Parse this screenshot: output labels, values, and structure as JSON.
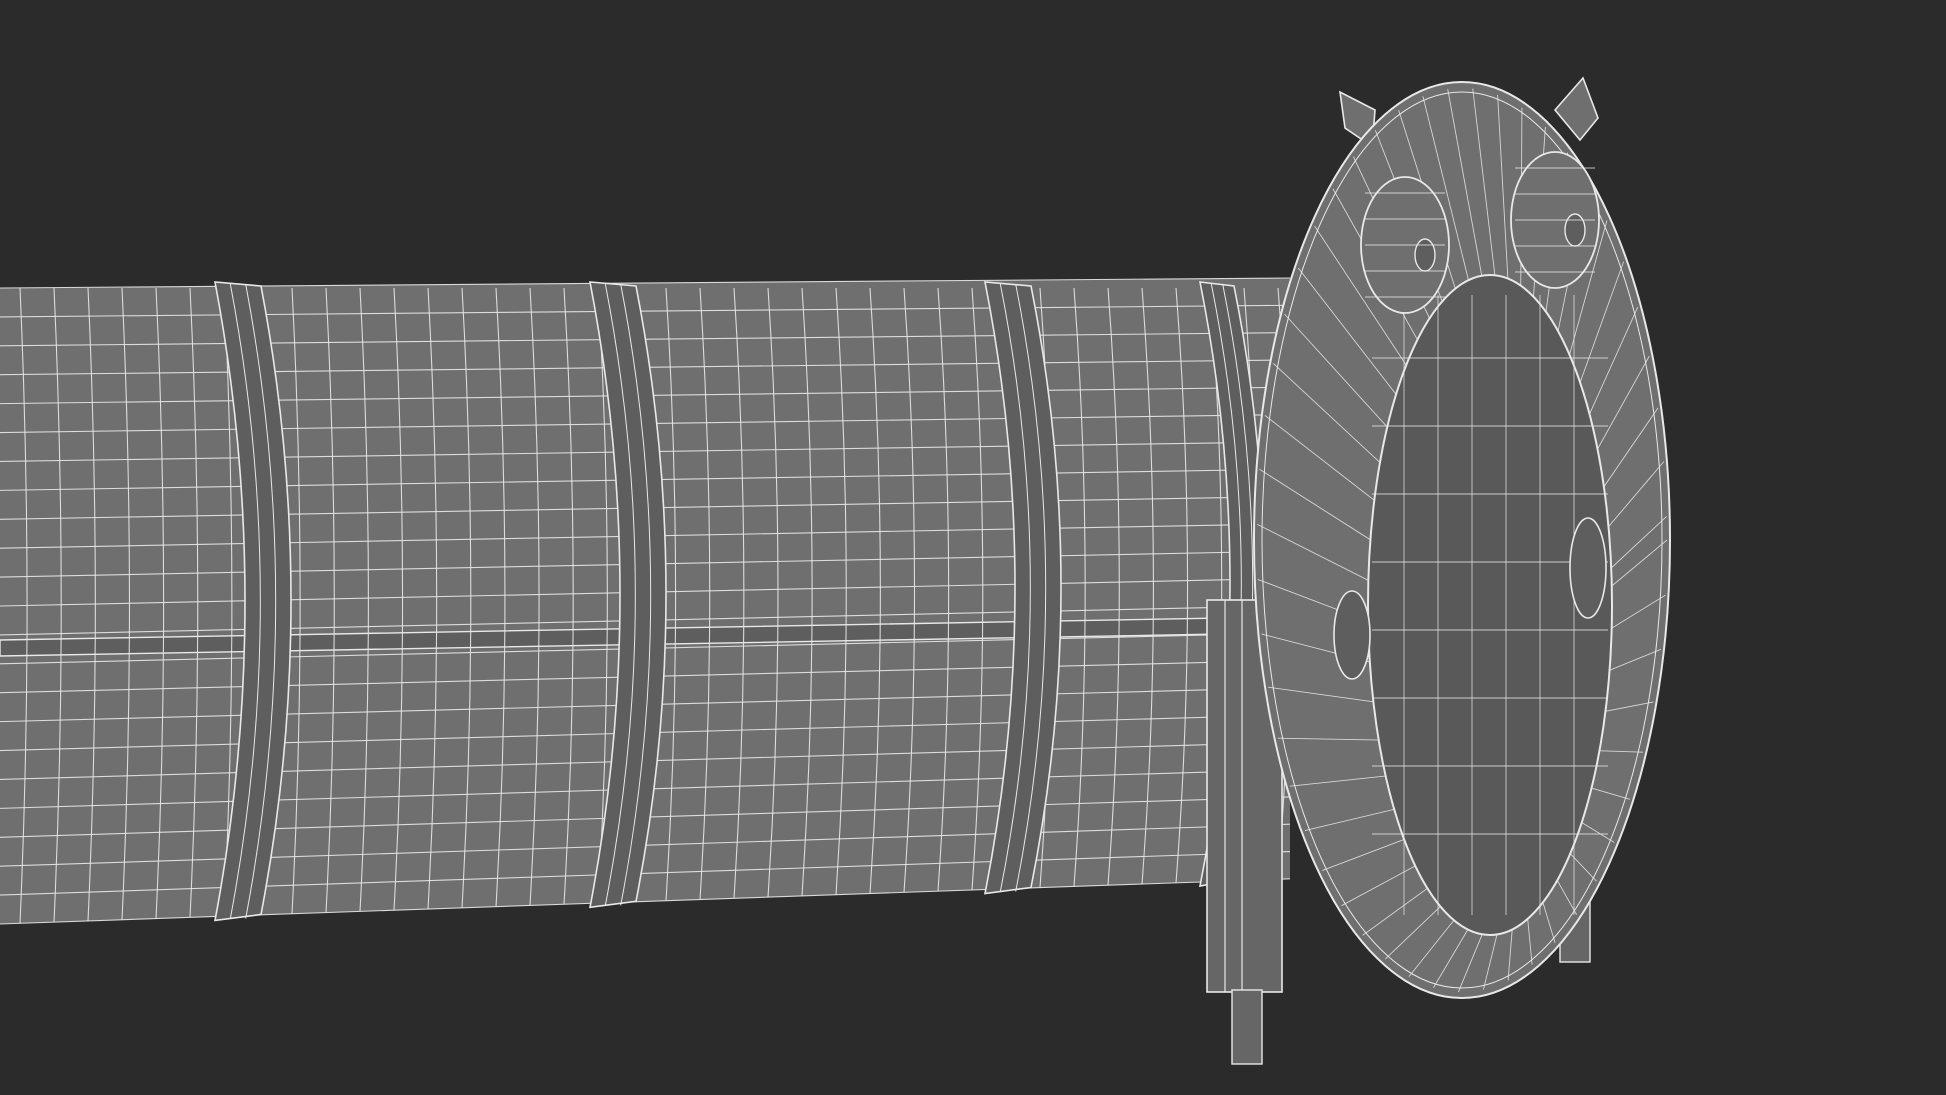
{
  "scene": {
    "background_color": "#2b2b2b",
    "shell_color": "#6f6f6f",
    "shell_dark_color": "#5e5e5e",
    "inner_color": "#595959",
    "wire_color": "#e8e8e8",
    "leg_color": "#666666"
  }
}
